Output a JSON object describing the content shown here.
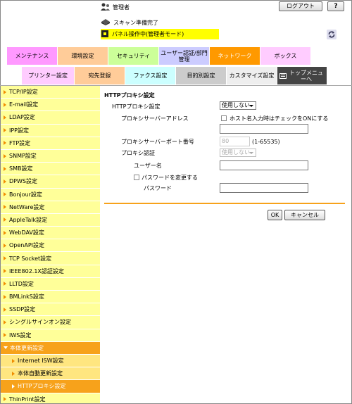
{
  "header": {
    "user_label": "管理者",
    "logout_label": "ログアウト",
    "help_label": "?",
    "status_scan": "スキャン準備完了",
    "status_panel": "パネル操作中(管理者モード)"
  },
  "tabs_row1": [
    {
      "label": "メンテナンス",
      "color": "#ff99ff"
    },
    {
      "label": "環境設定",
      "color": "#ffcc99"
    },
    {
      "label": "セキュリティ",
      "color": "#ccff99"
    },
    {
      "label": "ユーザー認証/部門管理",
      "color": "#ccccff"
    },
    {
      "label": "ネットワーク",
      "color": "#ff9900"
    },
    {
      "label": "ボックス",
      "color": "#ffccff"
    }
  ],
  "tabs_row2": [
    {
      "label": "プリンター設定",
      "color": "#ffccff"
    },
    {
      "label": "宛先登録",
      "color": "#ffcc99"
    },
    {
      "label": "ファクス設定",
      "color": "#ccffff"
    },
    {
      "label": "目的別設定",
      "color": "#cccccc"
    },
    {
      "label": "カスタマイズ設定",
      "color": "#eeeeee"
    },
    {
      "label": "トップメニューへ",
      "color": "#444444"
    }
  ],
  "sidebar": {
    "items": [
      {
        "label": "TCP/IP設定",
        "type": "normal"
      },
      {
        "label": "E-mail設定",
        "type": "normal"
      },
      {
        "label": "LDAP設定",
        "type": "normal"
      },
      {
        "label": "IPP設定",
        "type": "normal"
      },
      {
        "label": "FTP設定",
        "type": "normal"
      },
      {
        "label": "SNMP設定",
        "type": "normal"
      },
      {
        "label": "SMB設定",
        "type": "normal"
      },
      {
        "label": "DPWS設定",
        "type": "normal"
      },
      {
        "label": "Bonjour設定",
        "type": "normal"
      },
      {
        "label": "NetWare設定",
        "type": "normal"
      },
      {
        "label": "AppleTalk設定",
        "type": "normal"
      },
      {
        "label": "WebDAV設定",
        "type": "normal"
      },
      {
        "label": "OpenAPI設定",
        "type": "normal"
      },
      {
        "label": "TCP Socket設定",
        "type": "normal"
      },
      {
        "label": "IEEE802.1X認証設定",
        "type": "normal"
      },
      {
        "label": "LLTD設定",
        "type": "normal"
      },
      {
        "label": "BMLinkS設定",
        "type": "normal"
      },
      {
        "label": "SSDP設定",
        "type": "normal"
      },
      {
        "label": "シングルサインオン設定",
        "type": "normal"
      },
      {
        "label": "IWS設定",
        "type": "normal"
      },
      {
        "label": "本体更新設定",
        "type": "open"
      },
      {
        "label": "Internet ISW設定",
        "type": "sub"
      },
      {
        "label": "本体自動更新設定",
        "type": "sub"
      },
      {
        "label": "HTTPプロキシ設定",
        "type": "sub-active"
      },
      {
        "label": "ThinPrint設定",
        "type": "normal"
      }
    ]
  },
  "main": {
    "title": "HTTPプロキシ設定",
    "http_proxy_label": "HTTPプロキシ設定",
    "http_proxy_value": "使用しない",
    "proxy_address_label": "プロキシサーバーアドレス",
    "hostname_check_label": "ホスト名入力時はチェックをONにする",
    "proxy_port_label": "プロキシサーバーポート番号",
    "proxy_port_value": "80",
    "proxy_port_range": "(1-65535)",
    "proxy_auth_label": "プロキシ認証",
    "proxy_auth_value": "使用しない",
    "username_label": "ユーザー名",
    "change_password_label": "パスワードを変更する",
    "password_label": "パスワード",
    "ok_label": "OK",
    "cancel_label": "キャンセル"
  }
}
